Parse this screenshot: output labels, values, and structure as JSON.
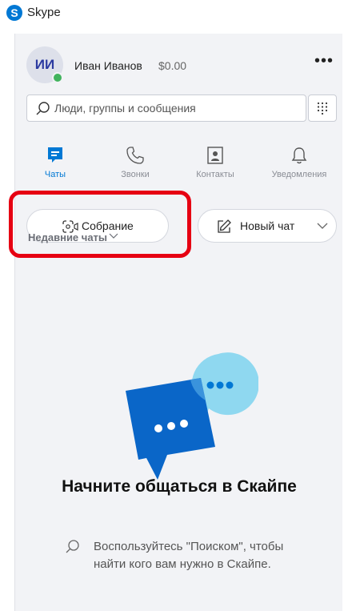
{
  "app": {
    "logo_letter": "S",
    "title": "Skype"
  },
  "profile": {
    "initials": "ИИ",
    "name": "Иван Иванов",
    "balance": "$0.00",
    "more": "•••",
    "presence_color": "#41b35d"
  },
  "search": {
    "placeholder": "Люди, группы и сообщения",
    "value": ""
  },
  "tabs": [
    {
      "label": "Чаты",
      "icon": "chat-icon",
      "active": true
    },
    {
      "label": "Звонки",
      "icon": "phone-icon",
      "active": false
    },
    {
      "label": "Контакты",
      "icon": "contacts-icon",
      "active": false
    },
    {
      "label": "Уведомления",
      "icon": "bell-icon",
      "active": false
    }
  ],
  "actions": {
    "meeting_label": "Собрание",
    "new_chat_label": "Новый чат"
  },
  "recent": {
    "label": "Недавние чаты"
  },
  "empty_state": {
    "title": "Начните общаться в Скайпе",
    "hint": "Воспользуйтесь \"Поиском\", чтобы найти кого вам нужно в Скайпе."
  },
  "colors": {
    "accent": "#0078d4",
    "highlight": "#e60012",
    "panel": "#f2f3f6"
  }
}
